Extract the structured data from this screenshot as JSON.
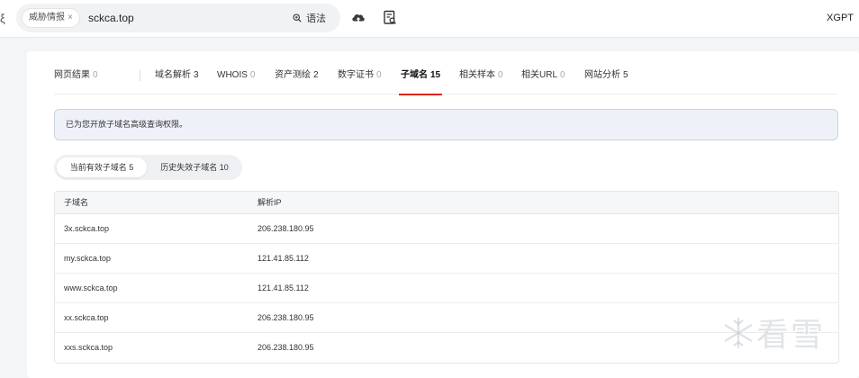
{
  "topbar": {
    "left_edge": "ξ",
    "search_tag": "威胁情报",
    "search_tag_close": "×",
    "search_value": "sckca.top",
    "syntax_icon": "magnifier-icon",
    "syntax_label": "语法",
    "upload_icon": "cloud-upload-icon",
    "report_icon": "document-search-icon",
    "user_label": "XGPT"
  },
  "tabs": [
    {
      "label": "网页结果",
      "count": "0"
    },
    {
      "label": "域名解析",
      "count": "3"
    },
    {
      "label": "WHOIS",
      "count": "0"
    },
    {
      "label": "资产测绘",
      "count": "2"
    },
    {
      "label": "数字证书",
      "count": "0"
    },
    {
      "label": "子域名",
      "count": "15"
    },
    {
      "label": "相关样本",
      "count": "0"
    },
    {
      "label": "相关URL",
      "count": "0"
    },
    {
      "label": "网站分析",
      "count": "5"
    }
  ],
  "active_tab_color": "#e0231f",
  "notice": "已为您开放子域名高级查询权限。",
  "segment": {
    "current": "当前有效子域名 5",
    "history": "历史失效子域名 10"
  },
  "table": {
    "headers": [
      "子域名",
      "解析IP"
    ],
    "rows": [
      [
        "3x.sckca.top",
        "206.238.180.95"
      ],
      [
        "my.sckca.top",
        "121.41.85.112"
      ],
      [
        "www.sckca.top",
        "121.41.85.112"
      ],
      [
        "xx.sckca.top",
        "206.238.180.95"
      ],
      [
        "xxs.sckca.top",
        "206.238.180.95"
      ]
    ]
  },
  "watermark": "看雪"
}
